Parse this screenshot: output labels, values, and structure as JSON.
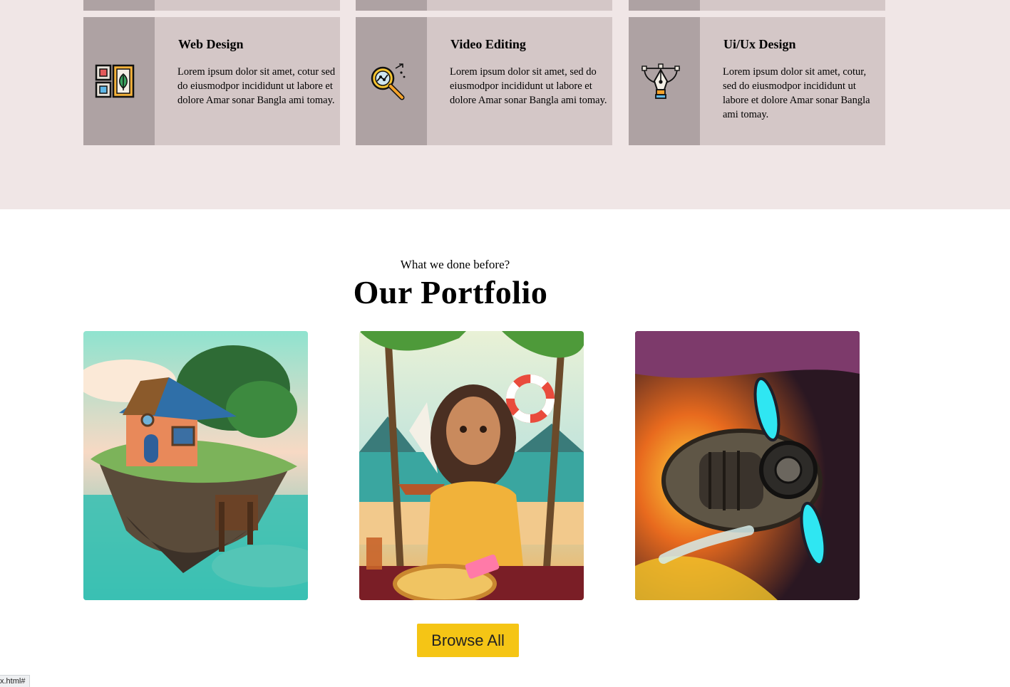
{
  "services": [
    {
      "icon": "frames-leaf-icon",
      "title": "Web Design",
      "text": "Lorem ipsum dolor sit amet, cotur sed do eiusmodpor incididunt ut labore et dolore Amar sonar Bangla ami tomay."
    },
    {
      "icon": "magnifier-graph-icon",
      "title": "Video Editing",
      "text": "Lorem ipsum dolor sit amet, sed do eiusmodpor incididunt ut labore et dolore Amar sonar Bangla ami tomay."
    },
    {
      "icon": "pen-tool-bezier-icon",
      "title": "Ui/Ux Design",
      "text": "Lorem ipsum dolor sit amet, cotur, sed do eiusmodpor incididunt ut labore et dolore Amar sonar Bangla ami tomay."
    }
  ],
  "portfolio": {
    "subtitle": "What we done before?",
    "title": "Our Portfolio",
    "items": [
      {
        "image": "floating-island-house-illustration"
      },
      {
        "image": "beach-girl-pizza-illustration"
      },
      {
        "image": "steampunk-airship-propeller-illustration"
      }
    ],
    "browse_label": "Browse All"
  },
  "status_bar": {
    "url": "x.html#"
  },
  "colors": {
    "band_bg": "#f0e6e6",
    "card_bg": "#d4c7c7",
    "icon_col_bg": "#aea2a3",
    "button_bg": "#f5c515"
  }
}
